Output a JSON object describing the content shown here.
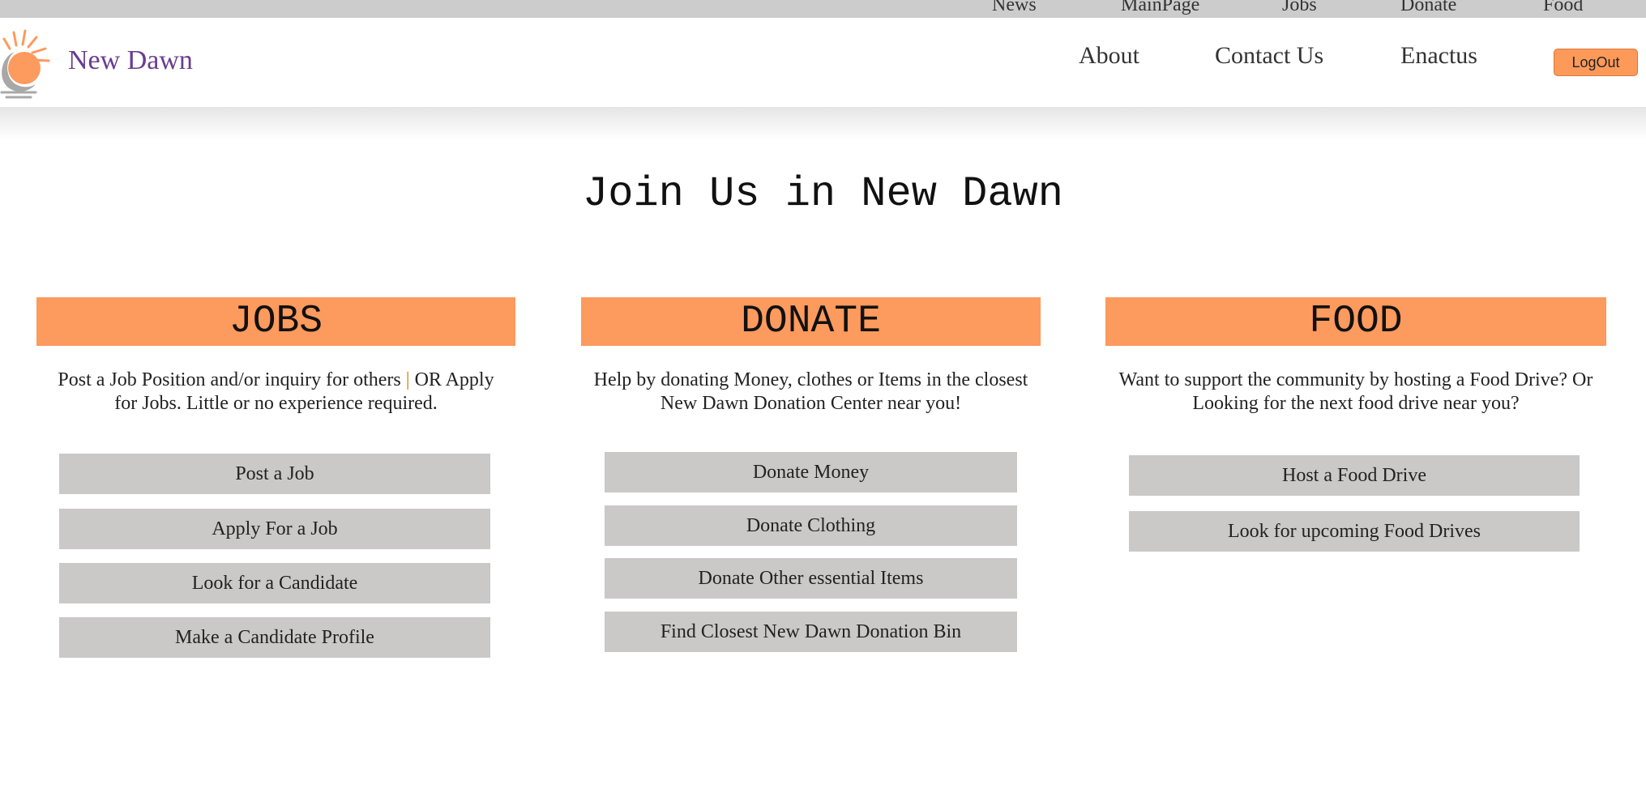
{
  "top_nav": {
    "items": [
      {
        "label": "News"
      },
      {
        "label": "MainPage"
      },
      {
        "label": "Jobs"
      },
      {
        "label": "Donate"
      },
      {
        "label": "Food"
      }
    ]
  },
  "header": {
    "brand": "New Dawn",
    "logo_icon": "sun-logo-icon",
    "nav": [
      {
        "label": "About"
      },
      {
        "label": "Contact Us"
      },
      {
        "label": "Enactus"
      }
    ],
    "logout_label": "LogOut"
  },
  "main": {
    "title": "Join Us in New Dawn",
    "columns": [
      {
        "heading": "JOBS",
        "description_part1": "Post a Job Position and/or inquiry for others",
        "description_separator": "|",
        "description_part2": "OR Apply for Jobs. Little or no experience required.",
        "buttons": [
          {
            "label": "Post a Job"
          },
          {
            "label": "Apply For a Job"
          },
          {
            "label": "Look for a Candidate"
          },
          {
            "label": "Make a Candidate Profile"
          }
        ]
      },
      {
        "heading": "DONATE",
        "description": "Help by donating Money, clothes or Items in the closest New Dawn Donation Center near you!",
        "buttons": [
          {
            "label": "Donate Money"
          },
          {
            "label": "Donate Clothing"
          },
          {
            "label": "Donate Other essential Items"
          },
          {
            "label": "Find Closest New Dawn Donation Bin"
          }
        ]
      },
      {
        "heading": "FOOD",
        "description": "Want to support the community by hosting a Food Drive? Or Looking for the next food drive near you?",
        "buttons": [
          {
            "label": "Host a Food Drive"
          },
          {
            "label": "Look for upcoming Food Drives"
          }
        ]
      }
    ]
  },
  "colors": {
    "accent_orange": "#fd9a5d",
    "button_gray": "#cbc8c8",
    "brand_purple": "#6a3d8f",
    "topbar_gray": "#cccccc"
  }
}
